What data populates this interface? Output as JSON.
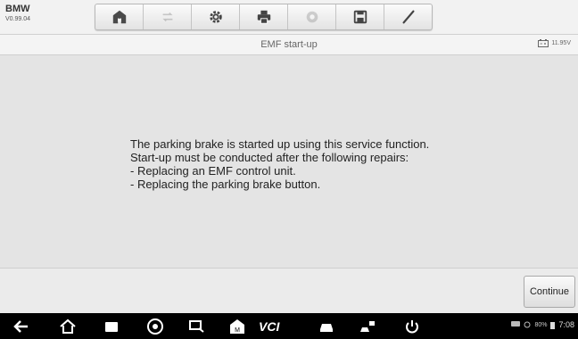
{
  "brand": {
    "name": "BMW",
    "version": "V0.99.04"
  },
  "toolbar": {
    "items": [
      {
        "icon": "home-icon"
      },
      {
        "icon": "vehicle-swap-icon",
        "disabled": true
      },
      {
        "icon": "settings-icon"
      },
      {
        "icon": "print-icon"
      },
      {
        "icon": "help-icon",
        "disabled": true
      },
      {
        "icon": "save-icon"
      },
      {
        "icon": "pen-icon"
      }
    ]
  },
  "header": {
    "title": "EMF start-up",
    "battery_voltage": "11.95V"
  },
  "message": {
    "lines": [
      "The parking brake is started up using this service function.",
      "Start-up must be conducted after the following repairs:",
      "- Replacing an EMF control unit.",
      "- Replacing the parking brake button."
    ]
  },
  "footer": {
    "continue_label": "Continue"
  },
  "system_bar": {
    "nav_icons": [
      "back-icon",
      "home-icon",
      "recent-apps-icon",
      "chrome-icon",
      "remote-icon",
      "maxi-home-icon",
      "vci-icon",
      "vehicle-icon",
      "shop-icon",
      "power-icon"
    ],
    "vci_label": "VCI",
    "battery_percent": "80%",
    "time": "7:08"
  },
  "colors": {
    "navbar": "#000000",
    "background": "#e4e4e4"
  }
}
